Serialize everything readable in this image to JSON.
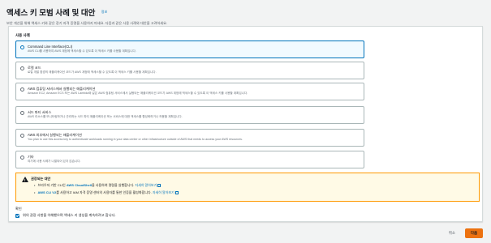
{
  "header": {
    "title": "액세스 키 모범 사례 및 대안",
    "info_link": "정보",
    "description": "보안 개선을 위해 액세스 키와 같은 장기 자격 증명을 사용하지 마세요. 다음과 같은 사용 사례와 대안을 고려하세요."
  },
  "use_case": {
    "label": "사용 사례",
    "options": [
      {
        "title": "Command Line Interface(CLI)",
        "desc": "AWS CLI를 사용하여 AWS 계정에 액세스할 수 있도록 이 액세스 키를 사용할 계획입니다.",
        "selected": true
      },
      {
        "title": "로컬 코드",
        "desc": "로컬 개발 환경의 애플리케이션 코드가 AWS 계정에 액세스할 수 있도록 이 액세스 키를 사용할 계획입니다.",
        "selected": false
      },
      {
        "title": "AWS 컴퓨팅 서비스에서 실행되는 애플리케이션",
        "desc": "Amazon EC2, Amazon ECS 또는 AWS Lambda와 같은 AWS 컴퓨팅 서비스에서 실행되는 애플리케이션 코드가 AWS 계정에 액세스할 수 있도록 이 액세스 키를 사용할 계획입니다.",
        "selected": false
      },
      {
        "title": "서드 파티 서비스",
        "desc": "AWS 리소스를 모니터링하거나 관리하는 서드 파티 애플리케이션 또는 서비스에 대한 액세스를 활성화하거나 허용할 계획입니다.",
        "selected": false
      },
      {
        "title": "AWS 외부에서 실행되는 애플리케이션",
        "desc": "You plan to use this access key to authenticate workloads running in your data center or other infrastructure outside of AWS that needs to access your AWS resources.",
        "selected": false
      },
      {
        "title": "기타",
        "desc": "여기에 사용 사례가 나열되어 있지 않습니다.",
        "selected": false
      }
    ]
  },
  "alert": {
    "title": "권장되는 대안",
    "items": [
      {
        "before": "브라우저 기반 CLI인 ",
        "link": "AWS CloudShell",
        "after": "을 사용하여 명령을 실행합니다. ",
        "more": "자세히 알아보기"
      },
      {
        "before": "",
        "link": "AWS CLI V2",
        "after": "를 사용하고 IAM 자격 증명 센터의 사용자를 통한 인증을 활성화합니다. ",
        "more": "자세히 알아보기"
      }
    ]
  },
  "confirmation": {
    "label": "확인",
    "text": "위의 권장 사항을 이해했으며 액세스 키 생성을 계속하려고 합니다.",
    "checked": true
  },
  "footer": {
    "cancel": "취소",
    "next": "다음"
  },
  "colors": {
    "link": "#0073bb",
    "primary_button": "#ec7211",
    "alert_border": "#ff9900",
    "alert_bg": "#fffae6"
  }
}
